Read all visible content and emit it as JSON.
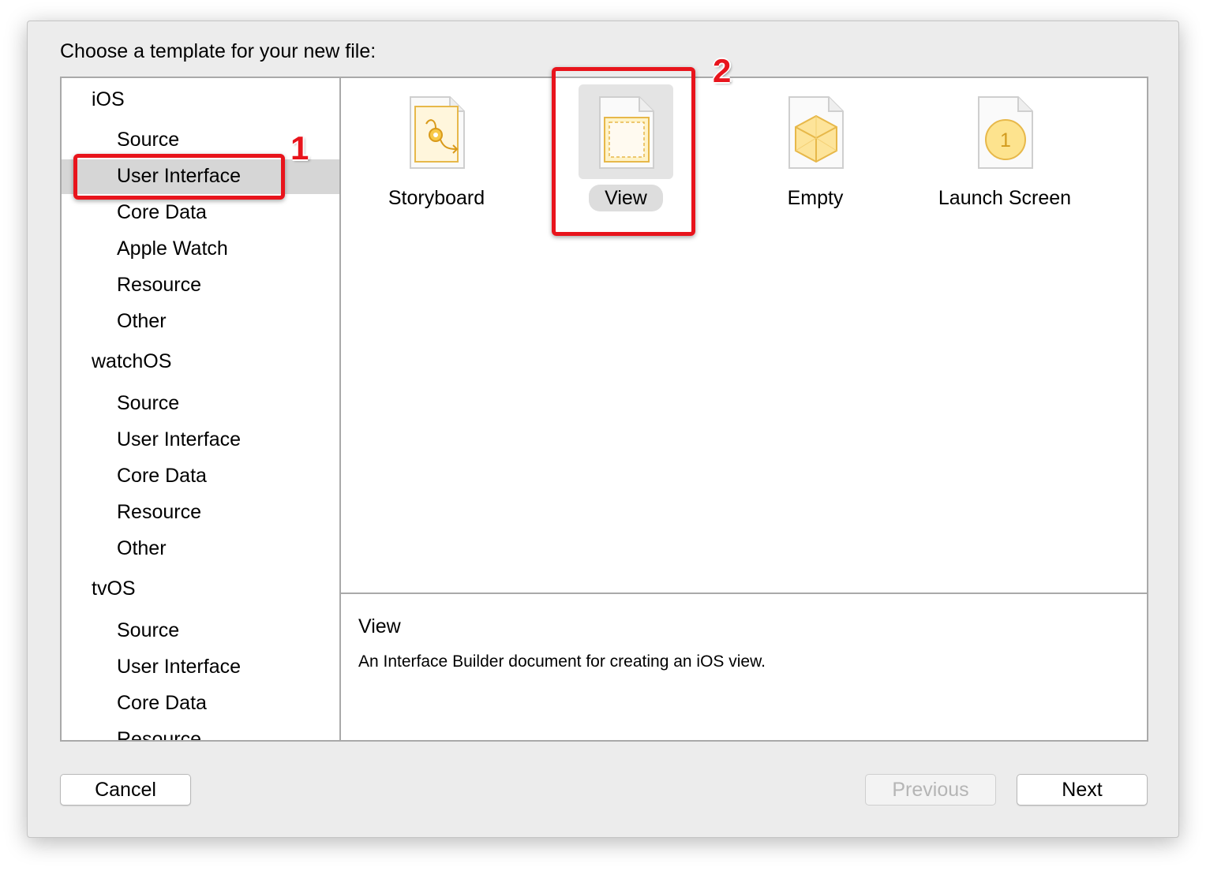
{
  "dialog": {
    "heading": "Choose a template for your new file:"
  },
  "sidebar": {
    "groups": [
      {
        "label": "iOS",
        "items": [
          "Source",
          "User Interface",
          "Core Data",
          "Apple Watch",
          "Resource",
          "Other"
        ]
      },
      {
        "label": "watchOS",
        "items": [
          "Source",
          "User Interface",
          "Core Data",
          "Resource",
          "Other"
        ]
      },
      {
        "label": "tvOS",
        "items": [
          "Source",
          "User Interface",
          "Core Data",
          "Resource"
        ]
      }
    ],
    "selected": "User Interface"
  },
  "templates": [
    {
      "label": "Storyboard",
      "icon": "storyboard-document-icon"
    },
    {
      "label": "View",
      "icon": "view-document-icon",
      "selected": true
    },
    {
      "label": "Empty",
      "icon": "empty-document-icon"
    },
    {
      "label": "Launch Screen",
      "icon": "launch-screen-document-icon"
    }
  ],
  "description": {
    "title": "View",
    "text": "An Interface Builder document for creating an iOS view."
  },
  "buttons": {
    "cancel": "Cancel",
    "previous": "Previous",
    "next": "Next"
  },
  "annotations": {
    "step1": "1",
    "step2": "2"
  },
  "colors": {
    "callout": "#e8141c",
    "selection": "#d6d6d6",
    "icon_accent": "#f0b429"
  }
}
